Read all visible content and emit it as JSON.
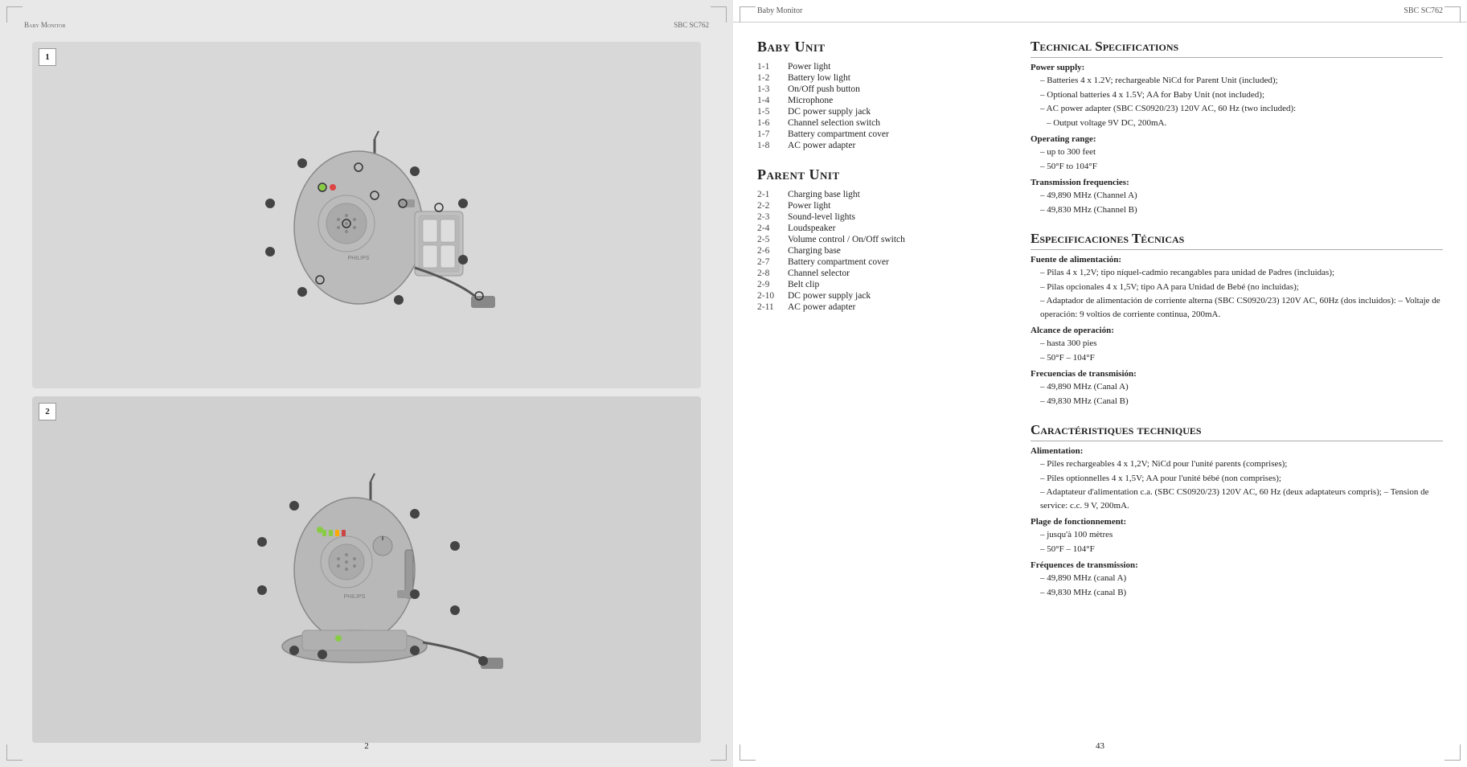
{
  "leftPage": {
    "header": {
      "brand": "Baby Monitor",
      "model": "SBC SC762"
    },
    "image1": {
      "number": "1",
      "label": "Baby Unit diagram"
    },
    "image2": {
      "number": "2",
      "label": "Parent Unit diagram"
    },
    "pageNumber": "2"
  },
  "rightPage": {
    "header": {
      "brand": "Baby Monitor",
      "model": "SBC SC762"
    },
    "babyUnit": {
      "title": "Baby Unit",
      "items": [
        {
          "num": "1-1",
          "label": "Power light"
        },
        {
          "num": "1-2",
          "label": "Battery low light"
        },
        {
          "num": "1-3",
          "label": "On/Off push button"
        },
        {
          "num": "1-4",
          "label": "Microphone"
        },
        {
          "num": "1-5",
          "label": "DC power supply jack"
        },
        {
          "num": "1-6",
          "label": "Channel selection switch"
        },
        {
          "num": "1-7",
          "label": "Battery compartment cover"
        },
        {
          "num": "1-8",
          "label": "AC power adapter"
        }
      ]
    },
    "parentUnit": {
      "title": "Parent Unit",
      "items": [
        {
          "num": "2-1",
          "label": "Charging base light"
        },
        {
          "num": "2-2",
          "label": "Power light"
        },
        {
          "num": "2-3",
          "label": "Sound-level lights"
        },
        {
          "num": "2-4",
          "label": "Loudspeaker"
        },
        {
          "num": "2-5",
          "label": "Volume control / On/Off switch"
        },
        {
          "num": "2-6",
          "label": "Charging base"
        },
        {
          "num": "2-7",
          "label": "Battery compartment cover"
        },
        {
          "num": "2-8",
          "label": "Channel selector"
        },
        {
          "num": "2-9",
          "label": "Belt clip"
        },
        {
          "num": "2-10",
          "label": "DC power supply jack"
        },
        {
          "num": "2-11",
          "label": "AC power adapter"
        }
      ]
    },
    "technical": {
      "title": "Technical Specifications",
      "powerSupply": {
        "subtitle": "Power supply:",
        "items": [
          "Batteries 4 x 1.2V; rechargeable NiCd for Parent Unit (included);",
          "Optional batteries 4 x 1.5V; AA for Baby Unit (not included);",
          "AC power adapter (SBC CS0920/23) 120V AC, 60 Hz (two included):",
          "Output voltage 9V DC, 200mA."
        ]
      },
      "operatingRange": {
        "subtitle": "Operating range:",
        "items": [
          "up to 300 feet",
          "50°F to 104°F"
        ]
      },
      "transmission": {
        "subtitle": "Transmission frequencies:",
        "items": [
          "49,890 MHz (Channel A)",
          "49,830 MHz (Channel B)"
        ]
      }
    },
    "especificaciones": {
      "title": "Especificaciones Técnicas",
      "fuente": {
        "subtitle": "Fuente de alimentación:",
        "items": [
          "Pilas 4 x 1,2V; tipo níquel-cadmio recangables para unidad de Padres (incluidas);",
          "Pilas opcionales 4 x 1,5V; tipo AA para Unidad de Bebé (no incluidas);",
          "Adaptador de alimentación de corriente alterna (SBC CS0920/23) 120V AC, 60Hz (dos incluidos): – Voltaje de operación: 9 voltios de corriente continua, 200mA."
        ]
      },
      "alcance": {
        "subtitle": "Alcance de operación:",
        "items": [
          "hasta 300 pies",
          "50°F – 104°F"
        ]
      },
      "frecuencias": {
        "subtitle": "Frecuencias de transmisión:",
        "items": [
          "49,890 MHz (Canal A)",
          "49,830 MHz (Canal B)"
        ]
      }
    },
    "caracteristiques": {
      "title": "Caractéristiques techniques",
      "alimentation": {
        "subtitle": "Alimentation:",
        "items": [
          "Piles rechargeables 4 x 1,2V; NiCd pour l'unité parents (comprises);",
          "Piles optionnelles 4 x 1,5V; AA pour l'unité bébé (non comprises);",
          "Adaptateur d'alimentation c.a. (SBC CS0920/23) 120V AC, 60 Hz (deux adaptateurs compris); – Tension de service: c.c. 9 V, 200mA."
        ]
      },
      "plage": {
        "subtitle": "Plage de fonctionnement:",
        "items": [
          "jusqu'à 100 mètres",
          "50°F – 104°F"
        ]
      },
      "frequences": {
        "subtitle": "Fréquences de transmission:",
        "items": [
          "49,890 MHz (canal A)",
          "49,830 MHz (canal B)"
        ]
      }
    },
    "pageNumber": "43"
  }
}
